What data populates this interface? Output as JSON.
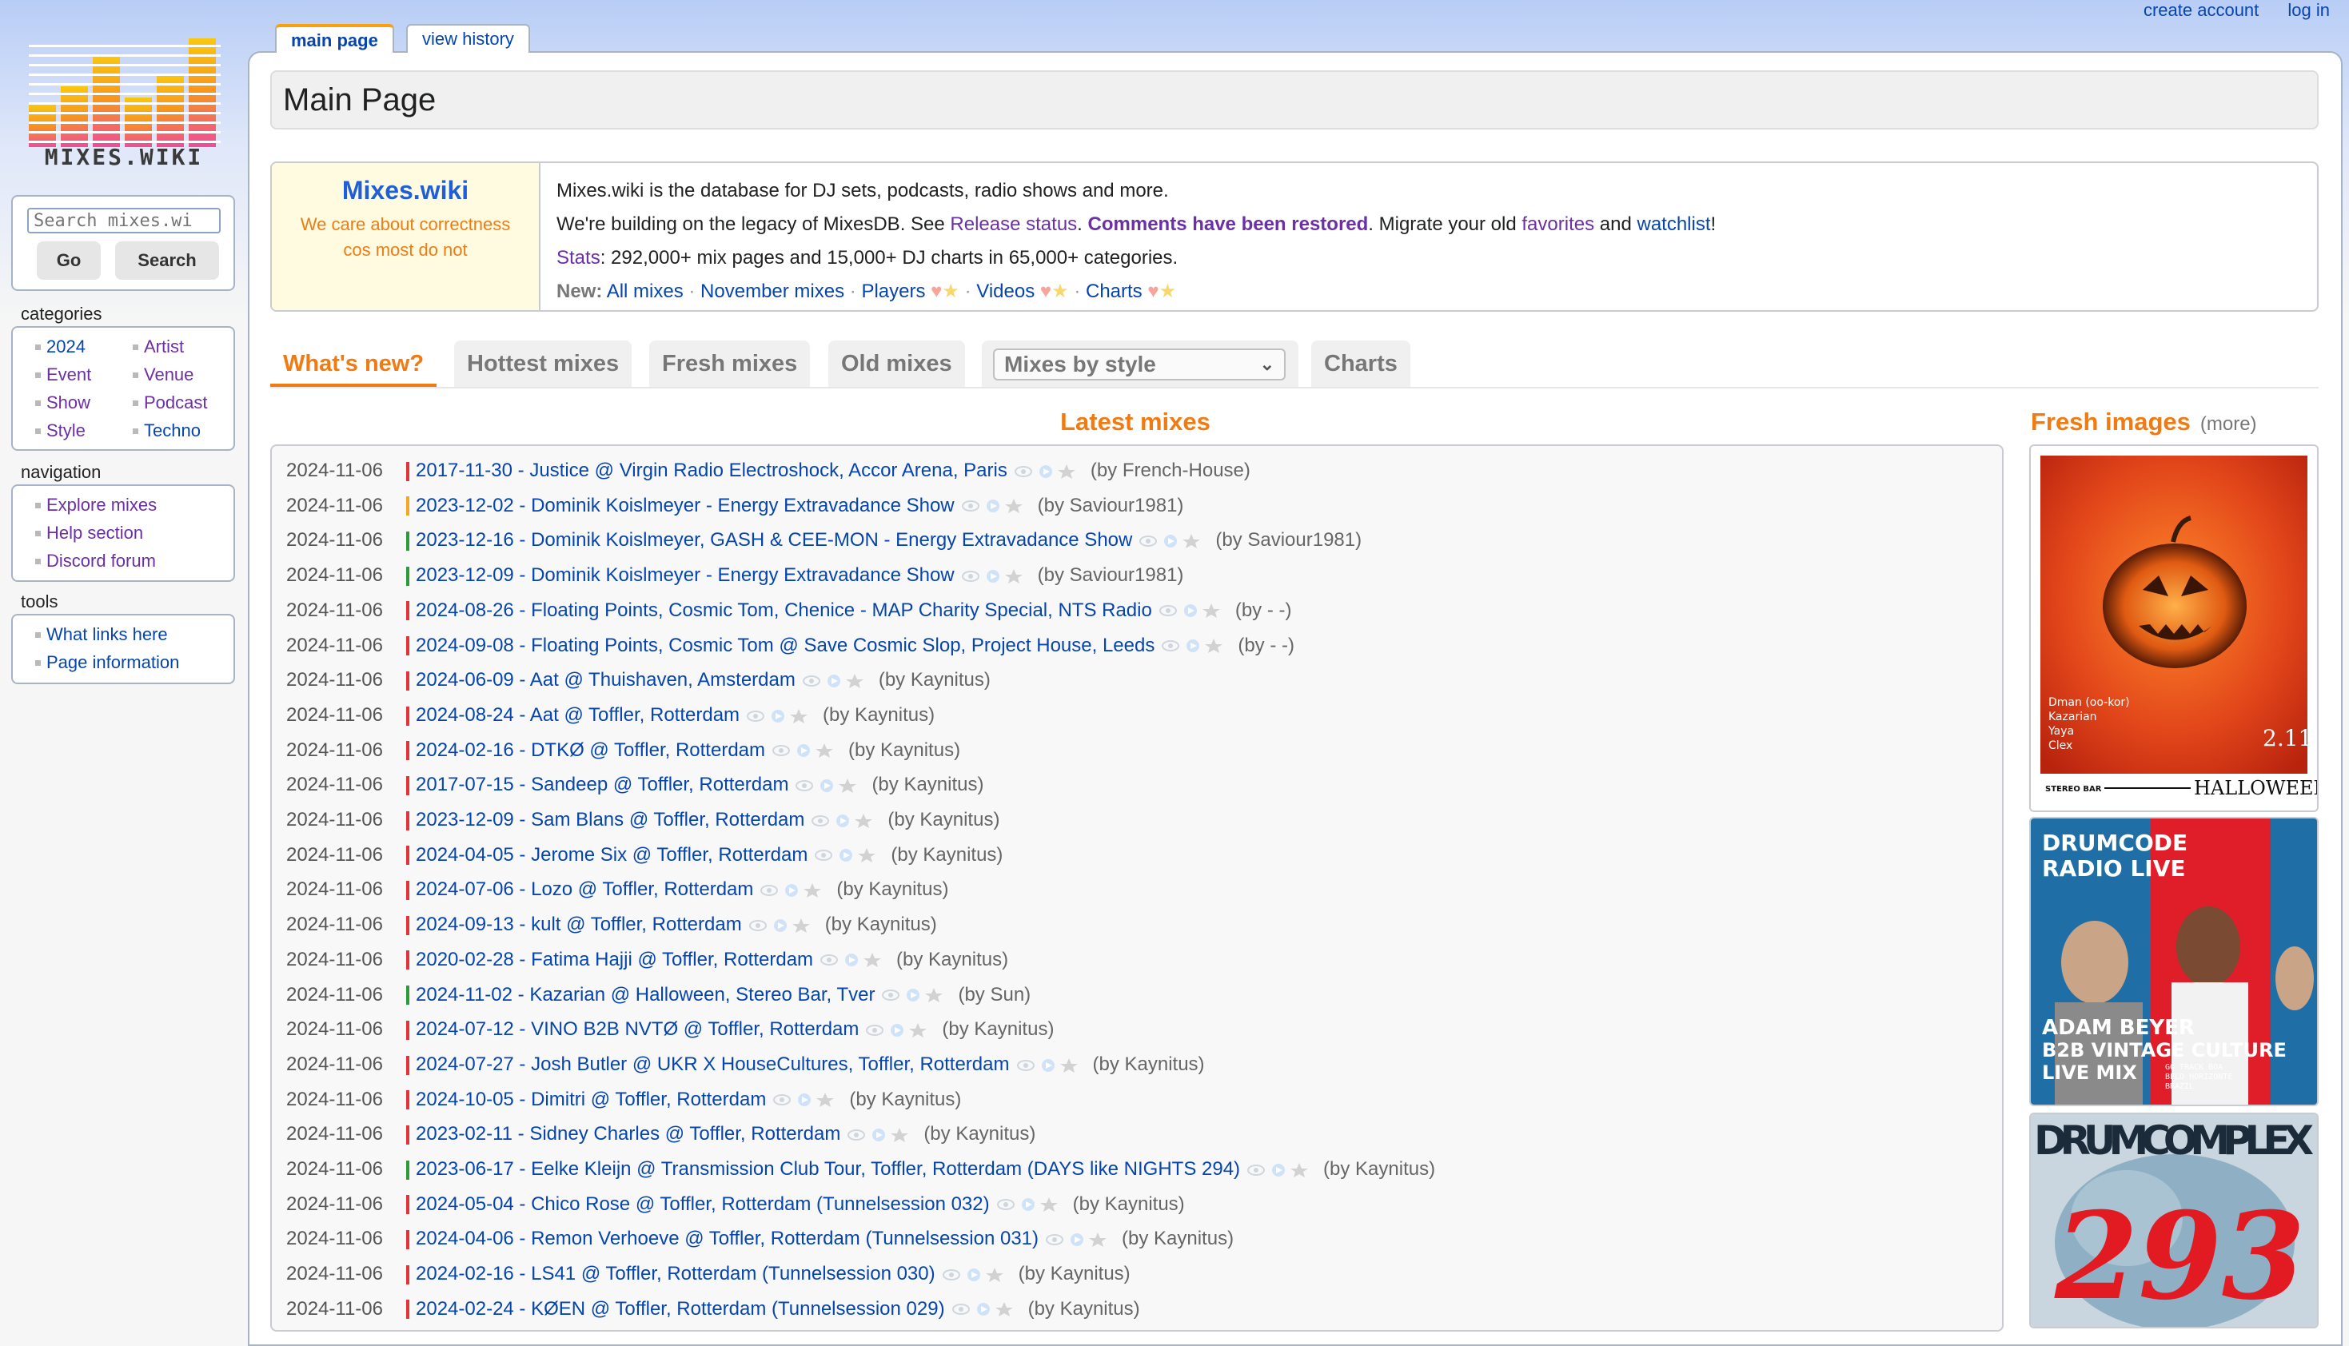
{
  "personal": {
    "create_account": "create account",
    "login": "log in"
  },
  "logo": {
    "text": "MIXES.WIKI"
  },
  "search": {
    "placeholder": "Search mixes.wi",
    "go": "Go",
    "search": "Search"
  },
  "sidebar": {
    "categories_title": "categories",
    "categories": [
      "2024",
      "Artist",
      "Event",
      "Venue",
      "Show",
      "Podcast",
      "Style",
      "Techno"
    ],
    "navigation_title": "navigation",
    "navigation": [
      "Explore mixes",
      "Help section",
      "Discord forum"
    ],
    "tools_title": "tools",
    "tools": [
      "What links here",
      "Page information"
    ]
  },
  "page_tabs": {
    "main": "main page",
    "history": "view history"
  },
  "page_title": "Main Page",
  "intro": {
    "site_name": "Mixes.wiki",
    "tagline1": "We care about correctness",
    "tagline2": "cos most do not",
    "line1": "Mixes.wiki is the database for DJ sets, podcasts, radio shows and more.",
    "line2_a": "We're building on the legacy of MixesDB. See ",
    "line2_release": "Release status",
    "line2_b": ". ",
    "line2_comments": "Comments have been restored",
    "line2_c": ". Migrate your old ",
    "line2_fav": "favorites",
    "line2_d": " and ",
    "line2_watch": "watchlist",
    "line2_e": "!",
    "line3_stats": "Stats",
    "line3_text": ": 292,000+ mix pages and 15,000+ DJ charts in 65,000+ categories.",
    "new_label": "New:",
    "new_all": "All mixes",
    "new_nov": "November mixes",
    "new_players": "Players",
    "new_videos": "Videos",
    "new_charts": "Charts",
    "sep": "·"
  },
  "main_tabs": {
    "new": "What's new?",
    "hot": "Hottest mixes",
    "fresh": "Fresh mixes",
    "old": "Old mixes",
    "style": "Mixes by style",
    "charts": "Charts"
  },
  "latest_title": "Latest mixes",
  "fresh_images": {
    "title": "Fresh images",
    "more": "(more)"
  },
  "colors": {
    "red": "#e0343a",
    "orange": "#f5a623",
    "green": "#2e9b3a"
  },
  "mixes": [
    {
      "date": "2024-11-06",
      "title": "2017-11-30 - Justice @ Virgin Radio Electroshock, Accor Arena, Paris",
      "by": "(by French-House)",
      "c": "red"
    },
    {
      "date": "2024-11-06",
      "title": "2023-12-02 - Dominik Koislmeyer - Energy Extravadance Show",
      "by": "(by Saviour1981)",
      "c": "orange"
    },
    {
      "date": "2024-11-06",
      "title": "2023-12-16 - Dominik Koislmeyer, GASH & CEE-MON - Energy Extravadance Show",
      "by": "(by Saviour1981)",
      "c": "green"
    },
    {
      "date": "2024-11-06",
      "title": "2023-12-09 - Dominik Koislmeyer - Energy Extravadance Show",
      "by": "(by Saviour1981)",
      "c": "green"
    },
    {
      "date": "2024-11-06",
      "title": "2024-08-26 - Floating Points, Cosmic Tom, Chenice - MAP Charity Special, NTS Radio",
      "by": "(by - -)",
      "c": "red"
    },
    {
      "date": "2024-11-06",
      "title": "2024-09-08 - Floating Points, Cosmic Tom @ Save Cosmic Slop, Project House, Leeds",
      "by": "(by - -)",
      "c": "red"
    },
    {
      "date": "2024-11-06",
      "title": "2024-06-09 - Aat @ Thuishaven, Amsterdam",
      "by": "(by Kaynitus)",
      "c": "red"
    },
    {
      "date": "2024-11-06",
      "title": "2024-08-24 - Aat @ Toffler, Rotterdam",
      "by": "(by Kaynitus)",
      "c": "red"
    },
    {
      "date": "2024-11-06",
      "title": "2024-02-16 - DTKØ @ Toffler, Rotterdam",
      "by": "(by Kaynitus)",
      "c": "red"
    },
    {
      "date": "2024-11-06",
      "title": "2017-07-15 - Sandeep @ Toffler, Rotterdam",
      "by": "(by Kaynitus)",
      "c": "red"
    },
    {
      "date": "2024-11-06",
      "title": "2023-12-09 - Sam Blans @ Toffler, Rotterdam",
      "by": "(by Kaynitus)",
      "c": "red"
    },
    {
      "date": "2024-11-06",
      "title": "2024-04-05 - Jerome Six @ Toffler, Rotterdam",
      "by": "(by Kaynitus)",
      "c": "red"
    },
    {
      "date": "2024-11-06",
      "title": "2024-07-06 - Lozo @ Toffler, Rotterdam",
      "by": "(by Kaynitus)",
      "c": "red"
    },
    {
      "date": "2024-11-06",
      "title": "2024-09-13 - kult @ Toffler, Rotterdam",
      "by": "(by Kaynitus)",
      "c": "red"
    },
    {
      "date": "2024-11-06",
      "title": "2020-02-28 - Fatima Hajji @ Toffler, Rotterdam",
      "by": "(by Kaynitus)",
      "c": "red"
    },
    {
      "date": "2024-11-06",
      "title": "2024-11-02 - Kazarian @ Halloween, Stereo Bar, Tver",
      "by": "(by Sun)",
      "c": "green"
    },
    {
      "date": "2024-11-06",
      "title": "2024-07-12 - VINO B2B NVTØ @ Toffler, Rotterdam",
      "by": "(by Kaynitus)",
      "c": "red"
    },
    {
      "date": "2024-11-06",
      "title": "2024-07-27 - Josh Butler @ UKR X HouseCultures, Toffler, Rotterdam",
      "by": "(by Kaynitus)",
      "c": "red"
    },
    {
      "date": "2024-11-06",
      "title": "2024-10-05 - Dimitri @ Toffler, Rotterdam",
      "by": "(by Kaynitus)",
      "c": "red"
    },
    {
      "date": "2024-11-06",
      "title": "2023-02-11 - Sidney Charles @ Toffler, Rotterdam",
      "by": "(by Kaynitus)",
      "c": "red"
    },
    {
      "date": "2024-11-06",
      "title": "2023-06-17 - Eelke Kleijn @ Transmission Club Tour, Toffler, Rotterdam (DAYS like NIGHTS 294)",
      "by": "(by Kaynitus)",
      "c": "green"
    },
    {
      "date": "2024-11-06",
      "title": "2024-05-04 - Chico Rose @ Toffler, Rotterdam (Tunnelsession 032)",
      "by": "(by Kaynitus)",
      "c": "red"
    },
    {
      "date": "2024-11-06",
      "title": "2024-04-06 - Remon Verhoeve @ Toffler, Rotterdam (Tunnelsession 031)",
      "by": "(by Kaynitus)",
      "c": "red"
    },
    {
      "date": "2024-11-06",
      "title": "2024-02-16 - LS41 @ Toffler, Rotterdam (Tunnelsession 030)",
      "by": "(by Kaynitus)",
      "c": "red"
    },
    {
      "date": "2024-11-06",
      "title": "2024-02-24 - KØEN @ Toffler, Rotterdam (Tunnelsession 029)",
      "by": "(by Kaynitus)",
      "c": "red"
    }
  ],
  "images": {
    "img1_lines": [
      "Dman (oo-kor)",
      "Kazarian",
      "Yaya",
      "Clex"
    ],
    "img1_number": "2.11",
    "img1_bar_left": "STEREO BAR",
    "img1_bar_right": "HALLOWEEN",
    "img2_title1": "DRUMCODE",
    "img2_title2": "RADIO LIVE",
    "img2_name": "ADAM BEYER",
    "img2_sub1": "B2B VINTAGE CULTURE",
    "img2_sub2": "LIVE MIX",
    "img2_small1": "GO TRACK BOA",
    "img2_small2": "BELO HORIZONTE",
    "img2_small3": "BRAZIL",
    "img3_title": "DRUMCOMPLEX",
    "img3_number": "293"
  }
}
